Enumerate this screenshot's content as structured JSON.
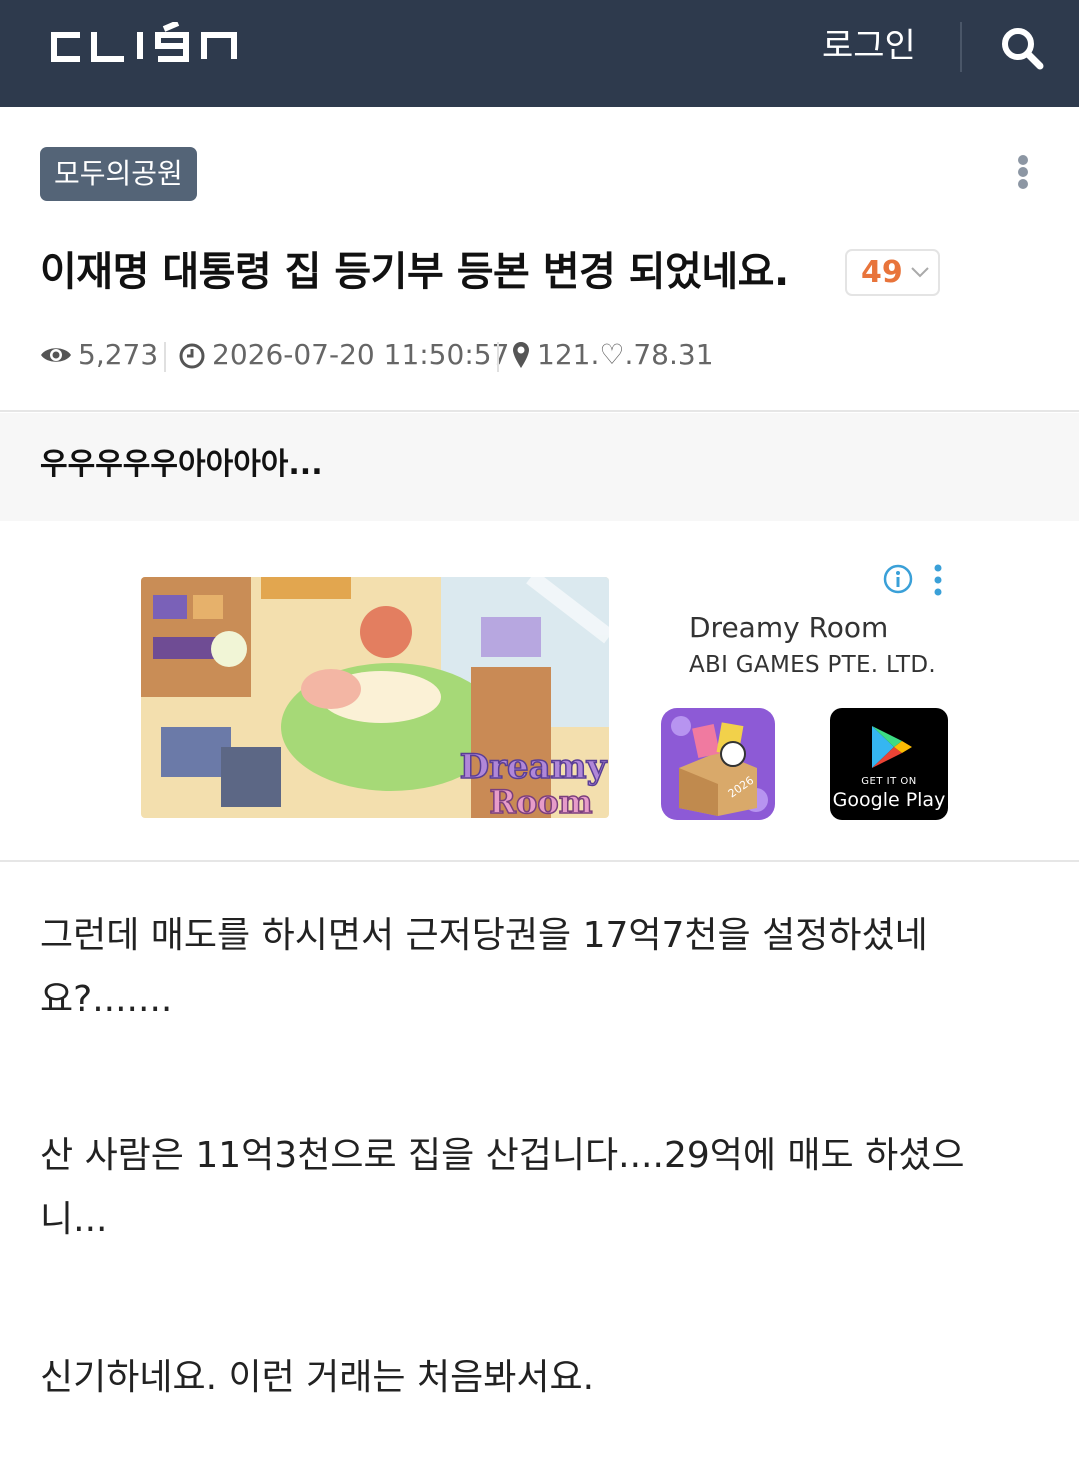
{
  "header": {
    "logo_text": "CLIEN",
    "login_label": "로그인",
    "background": "#2e3a4d"
  },
  "post": {
    "board": "모두의공원",
    "title": "이재명 대통령 집 등기부 등본 변경 되었네요.",
    "comment_count": "49",
    "views": "5,273",
    "datetime": "2026-07-20 11:50:57",
    "ip": "121.♡.78.31",
    "summary": "우우우우우아아아아...",
    "paragraphs": [
      "그런데 매도를 하시면서 근저당권을 17억7천을 설정하셨네요?.......",
      "산 사람은 11억3천으로 집을 산겁니다....29억에 매도 하셨으니...",
      "신기하네요. 이런 거래는 처음봐서요."
    ]
  },
  "ad": {
    "image_text_1": "Dreamy",
    "image_text_2": "Room",
    "app_name": "Dreamy Room",
    "publisher": "ABI GAMES PTE. LTD.",
    "icon_year": "2026",
    "store_small": "GET IT ON",
    "store_big": "Google Play"
  },
  "colors": {
    "accent_orange": "#e8743b",
    "badge_bg": "#546477",
    "meta_gray": "#666666"
  }
}
